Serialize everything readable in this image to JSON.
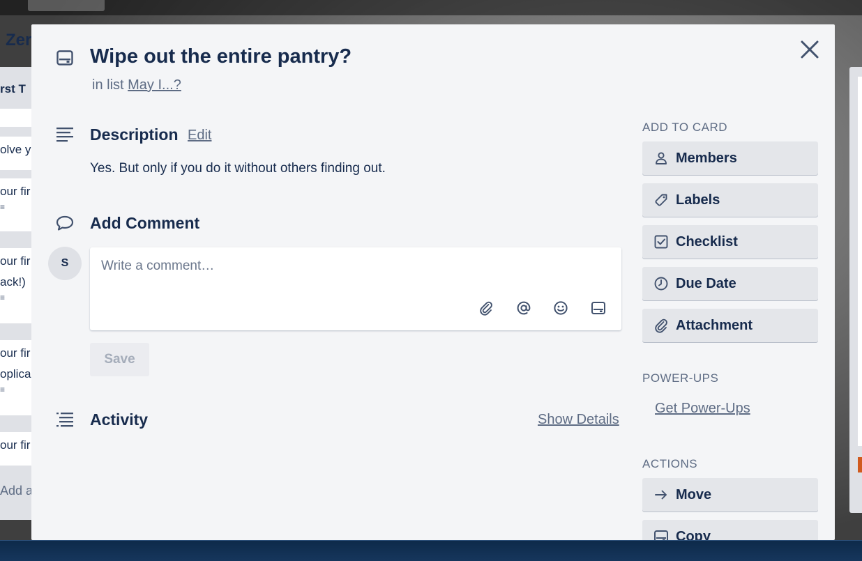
{
  "background": {
    "board_title": "Zer",
    "list_title": "rst T",
    "cards": [
      {
        "text": "olve y",
        "lines": ""
      },
      {
        "text": "our fir",
        "lines": "≡"
      },
      {
        "text": "our fir",
        "text2": "ack!)",
        "lines": "≡"
      },
      {
        "text": "our fir",
        "text2": "oplica",
        "lines": "≡"
      },
      {
        "text": "our fir",
        "lines": ""
      }
    ],
    "add_card": "Add a"
  },
  "card": {
    "title": "Wipe out the entire pantry?",
    "in_list_prefix": "in list",
    "list_name": "May I...?"
  },
  "description": {
    "title": "Description",
    "edit_label": "Edit",
    "text": "Yes. But only if you do it without others finding out."
  },
  "comment": {
    "title": "Add Comment",
    "avatar_initial": "S",
    "placeholder": "Write a comment…",
    "save_label": "Save"
  },
  "activity": {
    "title": "Activity",
    "show_details_label": "Show Details"
  },
  "sidebar": {
    "add_to_card_heading": "ADD TO CARD",
    "add_to_card": [
      {
        "label": "Members",
        "icon": "person-icon"
      },
      {
        "label": "Labels",
        "icon": "tag-icon"
      },
      {
        "label": "Checklist",
        "icon": "checklist-icon"
      },
      {
        "label": "Due Date",
        "icon": "clock-icon"
      },
      {
        "label": "Attachment",
        "icon": "paperclip-icon"
      }
    ],
    "power_ups_heading": "POWER-UPS",
    "get_power_ups_label": "Get Power-Ups",
    "actions_heading": "ACTIONS",
    "actions": [
      {
        "label": "Move",
        "icon": "arrow-right-icon"
      },
      {
        "label": "Copy",
        "icon": "card-icon"
      }
    ]
  },
  "colors": {
    "modal_bg": "#f4f5f7",
    "text_primary": "#172b4d",
    "text_secondary": "#5e6c84",
    "button_bg": "#e4e6ea",
    "taskbar": "#0d2a4a"
  }
}
